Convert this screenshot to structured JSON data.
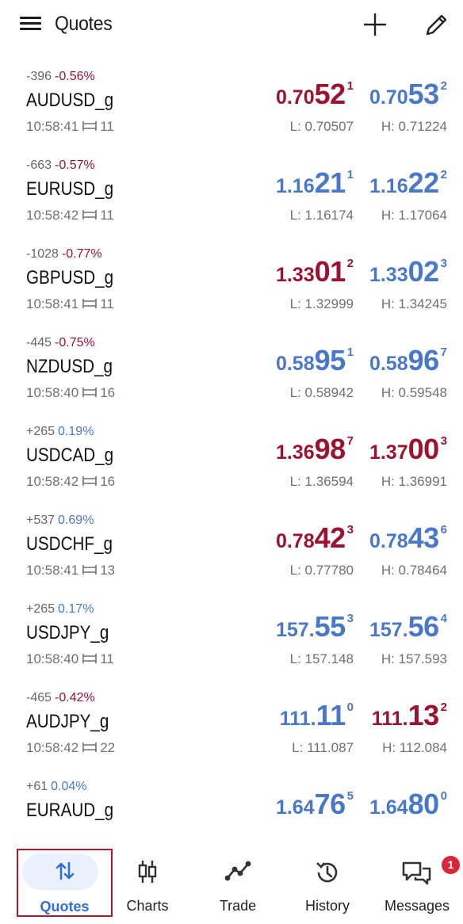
{
  "app": {
    "title": "Quotes"
  },
  "colors": {
    "up": "#4a78c8",
    "down": "#9b1330",
    "accent": "#2f6fd6",
    "badge": "#d9263a"
  },
  "quotes": [
    {
      "change_points": "-396",
      "change_pct": "-0.56%",
      "pct_dir": "down",
      "symbol": "AUDUSD_g",
      "time": "10:58:41",
      "spread": "11",
      "bid": {
        "dir": "down",
        "small": "0.70",
        "big": "52",
        "sup": "1"
      },
      "ask": {
        "dir": "up",
        "small": "0.70",
        "big": "53",
        "sup": "2"
      },
      "low": "L: 0.70507",
      "high": "H: 0.71224"
    },
    {
      "change_points": "-663",
      "change_pct": "-0.57%",
      "pct_dir": "down",
      "symbol": "EURUSD_g",
      "time": "10:58:42",
      "spread": "11",
      "bid": {
        "dir": "up",
        "small": "1.16",
        "big": "21",
        "sup": "1"
      },
      "ask": {
        "dir": "up",
        "small": "1.16",
        "big": "22",
        "sup": "2"
      },
      "low": "L: 1.16174",
      "high": "H: 1.17064"
    },
    {
      "change_points": "-1028",
      "change_pct": "-0.77%",
      "pct_dir": "down",
      "symbol": "GBPUSD_g",
      "time": "10:58:41",
      "spread": "11",
      "bid": {
        "dir": "down",
        "small": "1.33",
        "big": "01",
        "sup": "2"
      },
      "ask": {
        "dir": "up",
        "small": "1.33",
        "big": "02",
        "sup": "3"
      },
      "low": "L: 1.32999",
      "high": "H: 1.34245"
    },
    {
      "change_points": "-445",
      "change_pct": "-0.75%",
      "pct_dir": "down",
      "symbol": "NZDUSD_g",
      "time": "10:58:40",
      "spread": "16",
      "bid": {
        "dir": "up",
        "small": "0.58",
        "big": "95",
        "sup": "1"
      },
      "ask": {
        "dir": "up",
        "small": "0.58",
        "big": "96",
        "sup": "7"
      },
      "low": "L: 0.58942",
      "high": "H: 0.59548"
    },
    {
      "change_points": "+265",
      "change_pct": "0.19%",
      "pct_dir": "up",
      "symbol": "USDCAD_g",
      "time": "10:58:42",
      "spread": "16",
      "bid": {
        "dir": "down",
        "small": "1.36",
        "big": "98",
        "sup": "7"
      },
      "ask": {
        "dir": "down",
        "small": "1.37",
        "big": "00",
        "sup": "3"
      },
      "low": "L: 1.36594",
      "high": "H: 1.36991"
    },
    {
      "change_points": "+537",
      "change_pct": "0.69%",
      "pct_dir": "up",
      "symbol": "USDCHF_g",
      "time": "10:58:41",
      "spread": "13",
      "bid": {
        "dir": "down",
        "small": "0.78",
        "big": "42",
        "sup": "3"
      },
      "ask": {
        "dir": "up",
        "small": "0.78",
        "big": "43",
        "sup": "6"
      },
      "low": "L: 0.77780",
      "high": "H: 0.78464"
    },
    {
      "change_points": "+265",
      "change_pct": "0.17%",
      "pct_dir": "up",
      "symbol": "USDJPY_g",
      "time": "10:58:40",
      "spread": "11",
      "bid": {
        "dir": "up",
        "small": "157.",
        "big": "55",
        "sup": "3"
      },
      "ask": {
        "dir": "up",
        "small": "157.",
        "big": "56",
        "sup": "4"
      },
      "low": "L: 157.148",
      "high": "H: 157.593"
    },
    {
      "change_points": "-465",
      "change_pct": "-0.42%",
      "pct_dir": "down",
      "symbol": "AUDJPY_g",
      "time": "10:58:42",
      "spread": "22",
      "bid": {
        "dir": "up",
        "small": "111.",
        "big": "11",
        "sup": "0"
      },
      "ask": {
        "dir": "down",
        "small": "111.",
        "big": "13",
        "sup": "2"
      },
      "low": "L: 111.087",
      "high": "H: 112.084"
    },
    {
      "change_points": "+61",
      "change_pct": "0.04%",
      "pct_dir": "up",
      "symbol": "EURAUD_g",
      "time": "",
      "spread": "",
      "bid": {
        "dir": "up",
        "small": "1.64",
        "big": "76",
        "sup": "5"
      },
      "ask": {
        "dir": "up",
        "small": "1.64",
        "big": "80",
        "sup": "0"
      },
      "low": "",
      "high": ""
    }
  ],
  "nav": {
    "quotes": "Quotes",
    "charts": "Charts",
    "trade": "Trade",
    "history": "History",
    "messages": "Messages",
    "messages_badge": "1"
  },
  "icons": [
    "menu-icon",
    "plus-icon",
    "pencil-icon",
    "spread-icon",
    "sort-arrows-icon",
    "candlestick-icon",
    "trend-line-icon",
    "history-clock-icon",
    "chat-bubbles-icon"
  ]
}
